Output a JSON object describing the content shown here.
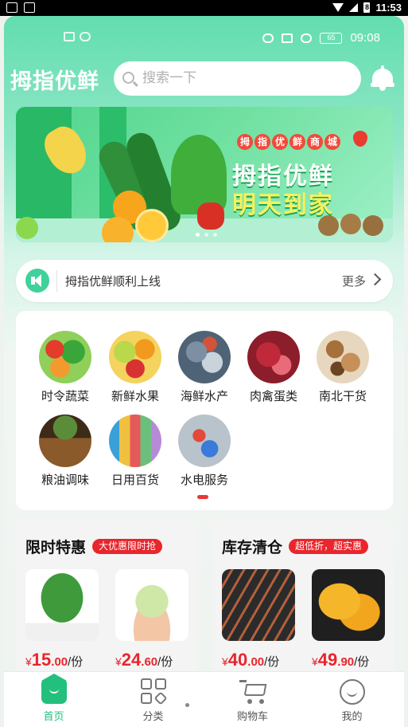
{
  "system_status": {
    "time": "11:53",
    "battery_level": "8"
  },
  "inner_status": {
    "time": "09:08",
    "battery": "65"
  },
  "header": {
    "brand": "拇指优鲜",
    "search_placeholder": "搜索一下"
  },
  "banner": {
    "tag_chars": [
      "拇",
      "指",
      "优",
      "鲜",
      "商",
      "城"
    ],
    "headline": "拇指优鲜",
    "subheadline": "明天到家"
  },
  "notice": {
    "text": "拇指优鲜顺利上线",
    "more": "更多"
  },
  "categories": [
    {
      "label": "时令蔬菜",
      "icon": "vegetables-image"
    },
    {
      "label": "新鲜水果",
      "icon": "fruits-image"
    },
    {
      "label": "海鲜水产",
      "icon": "seafood-image"
    },
    {
      "label": "肉禽蛋类",
      "icon": "meat-image"
    },
    {
      "label": "南北干货",
      "icon": "dried-goods-image"
    },
    {
      "label": "粮油调味",
      "icon": "grain-oil-image"
    },
    {
      "label": "日用百货",
      "icon": "daily-goods-image"
    },
    {
      "label": "水电服务",
      "icon": "utility-service-image"
    }
  ],
  "deals": [
    {
      "title": "限时特惠",
      "badge": "大优惠限时抢",
      "products": [
        {
          "name": "spinach",
          "price_int": "15",
          "price_dec": ".00",
          "unit": "/份"
        },
        {
          "name": "cabbage",
          "price_int": "24",
          "price_dec": ".60",
          "unit": "/份"
        }
      ]
    },
    {
      "title": "库存清仓",
      "badge": "超低折，超实惠",
      "products": [
        {
          "name": "chopsticks",
          "price_int": "40",
          "price_dec": ".00",
          "unit": "/份"
        },
        {
          "name": "mango",
          "price_int": "49",
          "price_dec": ".90",
          "unit": "/份"
        }
      ]
    }
  ],
  "currency": "¥",
  "tabs": [
    {
      "label": "首页",
      "icon": "home-icon",
      "active": true
    },
    {
      "label": "分类",
      "icon": "category-grid-icon",
      "active": false
    },
    {
      "label": "购物车",
      "icon": "cart-icon",
      "active": false
    },
    {
      "label": "我的",
      "icon": "profile-icon",
      "active": false
    }
  ],
  "colors": {
    "accent": "#22c07c",
    "price": "#e8262c",
    "header_gradient_top": "#63ddb0"
  }
}
